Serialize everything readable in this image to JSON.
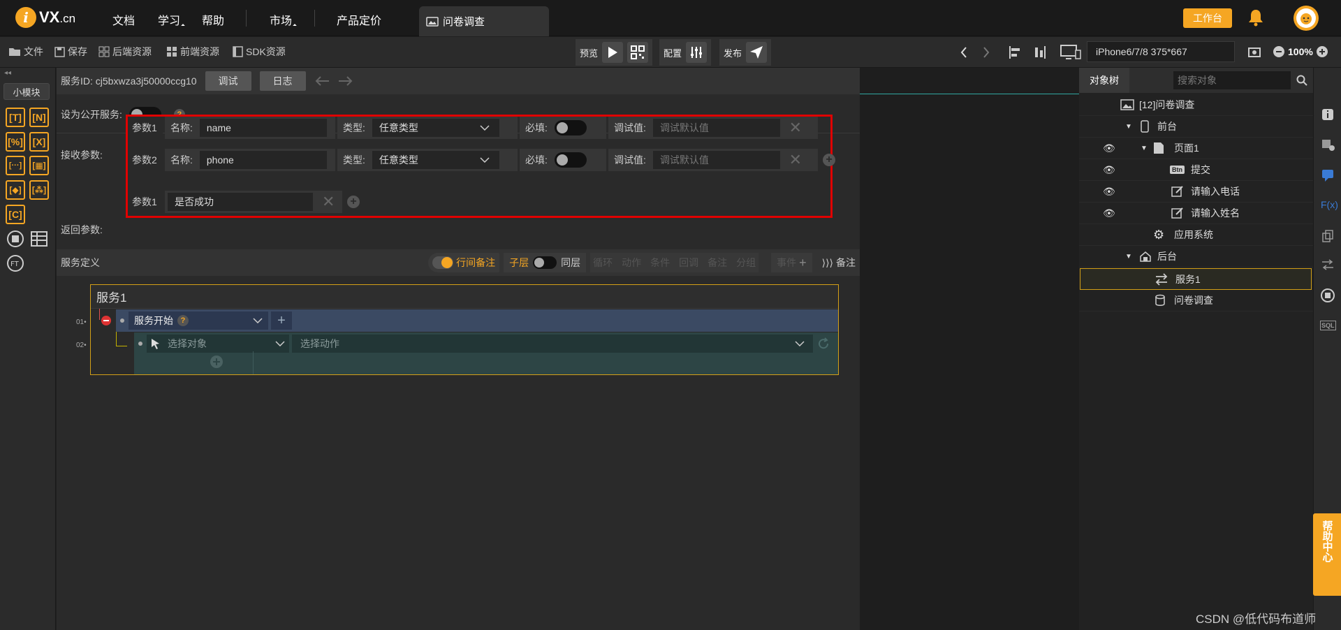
{
  "topbar": {
    "brand_main": "VX",
    "brand_suffix": ".cn",
    "nav": [
      "文档",
      "学习",
      "帮助",
      "市场",
      "产品定价"
    ],
    "doc_tab": "问卷调查",
    "workbench": "工作台"
  },
  "toolbar": {
    "file": "文件",
    "save": "保存",
    "backend_res": "后端资源",
    "frontend_res": "前端资源",
    "sdk_res": "SDK资源",
    "preview": "预览",
    "config": "配置",
    "publish": "发布",
    "device": "iPhone6/7/8 375*667",
    "zoom": "100%"
  },
  "left_rail": {
    "mini_module": "小模块",
    "icons": [
      "[T]",
      "[N]",
      "[%]",
      "[X]",
      "[···]",
      "[▦]",
      "[◆]",
      "[⁂]",
      "[C]"
    ]
  },
  "service": {
    "id_label": "服务ID:",
    "id_value": "cj5bxwza3j50000ccg10",
    "debug": "调试",
    "log": "日志",
    "public_label": "设为公开服务:",
    "recv_label": "接收参数:",
    "return_label": "返回参数:",
    "params": [
      {
        "tag": "参数1",
        "name_label": "名称:",
        "name": "name",
        "type_label": "类型:",
        "type": "任意类型",
        "required_label": "必填:",
        "debug_label": "调试值:",
        "debug_placeholder": "调试默认值"
      },
      {
        "tag": "参数2",
        "name_label": "名称:",
        "name": "phone",
        "type_label": "类型:",
        "type": "任意类型",
        "required_label": "必填:",
        "debug_label": "调试值:",
        "debug_placeholder": "调试默认值"
      }
    ],
    "return_param": {
      "tag": "参数1",
      "value": "是否成功"
    }
  },
  "definition": {
    "title": "服务定义",
    "row_note": "行间备注",
    "child_layer": "子层",
    "same_layer": "同层",
    "tools": [
      "循环",
      "动作",
      "条件",
      "回调",
      "备注",
      "分组"
    ],
    "event": "事件",
    "notes": "备注",
    "service_name": "服务1",
    "row1_num": "01",
    "row2_num": "02",
    "start": "服务开始",
    "select_object": "选择对象",
    "select_action": "选择动作"
  },
  "tree": {
    "tab": "对象树",
    "search_placeholder": "搜索对象",
    "nodes": [
      "[12]问卷调查",
      "前台",
      "页面1",
      "提交",
      "请输入电话",
      "请输入姓名",
      "应用系统",
      "后台",
      "服务1",
      "问卷调查"
    ],
    "btn_badge": "Btn"
  },
  "help_center": "帮助中心",
  "watermark": "CSDN @低代码布道师",
  "colors": {
    "accent": "#f5a623",
    "highlight_border": "#e00000",
    "selection": "#d4a017"
  }
}
